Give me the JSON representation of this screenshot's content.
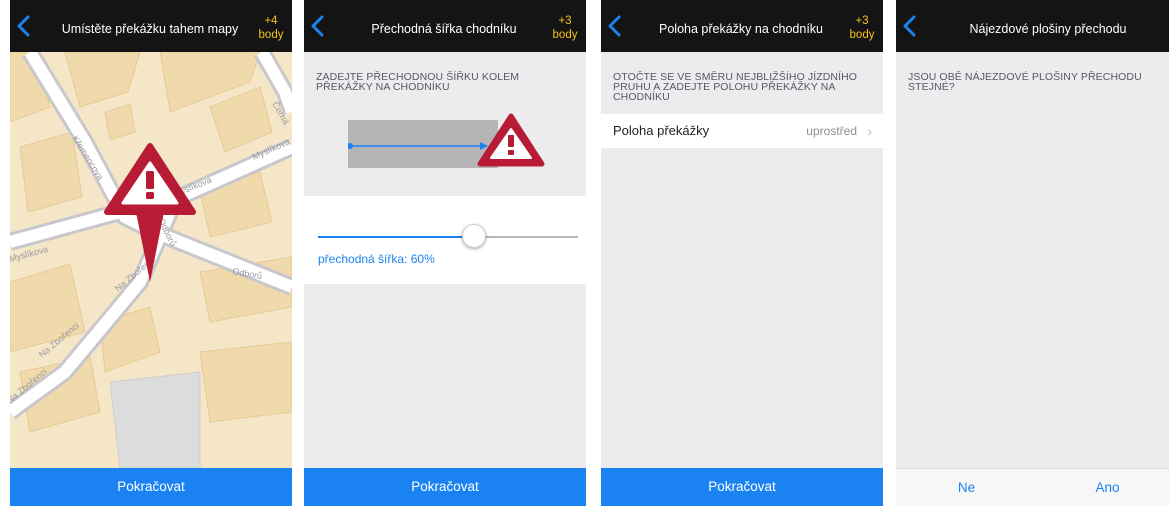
{
  "colors": {
    "topbar": "#141414",
    "accent": "#1b83f1",
    "points": "#f2c21a",
    "warning": "#b71c34"
  },
  "screens": [
    {
      "title": "Umístěte překážku tahem mapy",
      "points_value": "+4",
      "points_unit": "body",
      "streets": [
        "Myslíkova",
        "Křemencova",
        "Myslíkova",
        "Myslíkova",
        "Odborů",
        "Na Zbořenci",
        "Na Zbořenci",
        "Odborů",
        "Černá",
        "Na Zbořenci"
      ],
      "continue_label": "Pokračovat"
    },
    {
      "title": "Přechodná šířka chodníku",
      "points_value": "+3",
      "points_unit": "body",
      "instruction": "ZADEJTE PŘECHODNOU ŠÍŘKU KOLEM PŘEKÁŽKY NA CHODNÍKU",
      "slider_value": 0.6,
      "slider_label": "přechodná šířka: 60%",
      "continue_label": "Pokračovat"
    },
    {
      "title": "Poloha překážky na chodníku",
      "points_value": "+3",
      "points_unit": "body",
      "instruction": "OTOČTE SE VE SMĚRU NEJBLIŽŠÍHO JÍZDNÍHO PRUHU A ZADEJTE POLOHU PŘEKÁŽKY NA CHODNÍKU",
      "row_label": "Poloha překážky",
      "row_value": "uprostřed",
      "continue_label": "Pokračovat"
    },
    {
      "title": "Nájezdové plošiny přechodu",
      "question": "JSOU OBĚ NÁJEZDOVÉ PLOŠINY PŘECHODU STEJNÉ?",
      "no_label": "Ne",
      "yes_label": "Ano"
    }
  ]
}
